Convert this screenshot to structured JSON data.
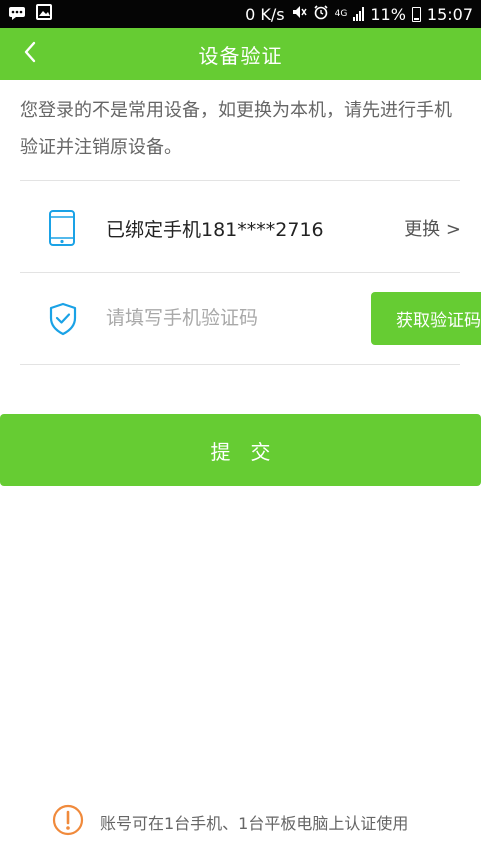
{
  "status_bar": {
    "net_speed": "0 K/s",
    "network_type": "4G",
    "battery_percent": "11%",
    "time": "15:07",
    "icons": [
      "chat-notification-icon",
      "image-notification-icon",
      "mute-icon",
      "alarm-icon",
      "signal-icon",
      "battery-icon"
    ]
  },
  "header": {
    "title": "设备验证",
    "back_icon": "chevron-left-icon"
  },
  "notice": {
    "text": "您登录的不是常用设备，如更换为本机，请先进行手机验证并注销原设备。"
  },
  "phone": {
    "bound_text": "已绑定手机181****2716",
    "change_label": "更换 >",
    "icon": "phone-icon"
  },
  "code": {
    "placeholder": "请填写手机验证码",
    "value": "",
    "get_code_label": "获取验证码",
    "icon": "shield-check-icon"
  },
  "submit": {
    "label": "提交"
  },
  "footer": {
    "tip": "账号可在1台手机、1台平板电脑上认证使用",
    "icon": "warning-icon"
  },
  "colors": {
    "accent": "#66cc33",
    "icon_blue": "#1aa2e6",
    "warning_orange": "#f08a3c"
  }
}
